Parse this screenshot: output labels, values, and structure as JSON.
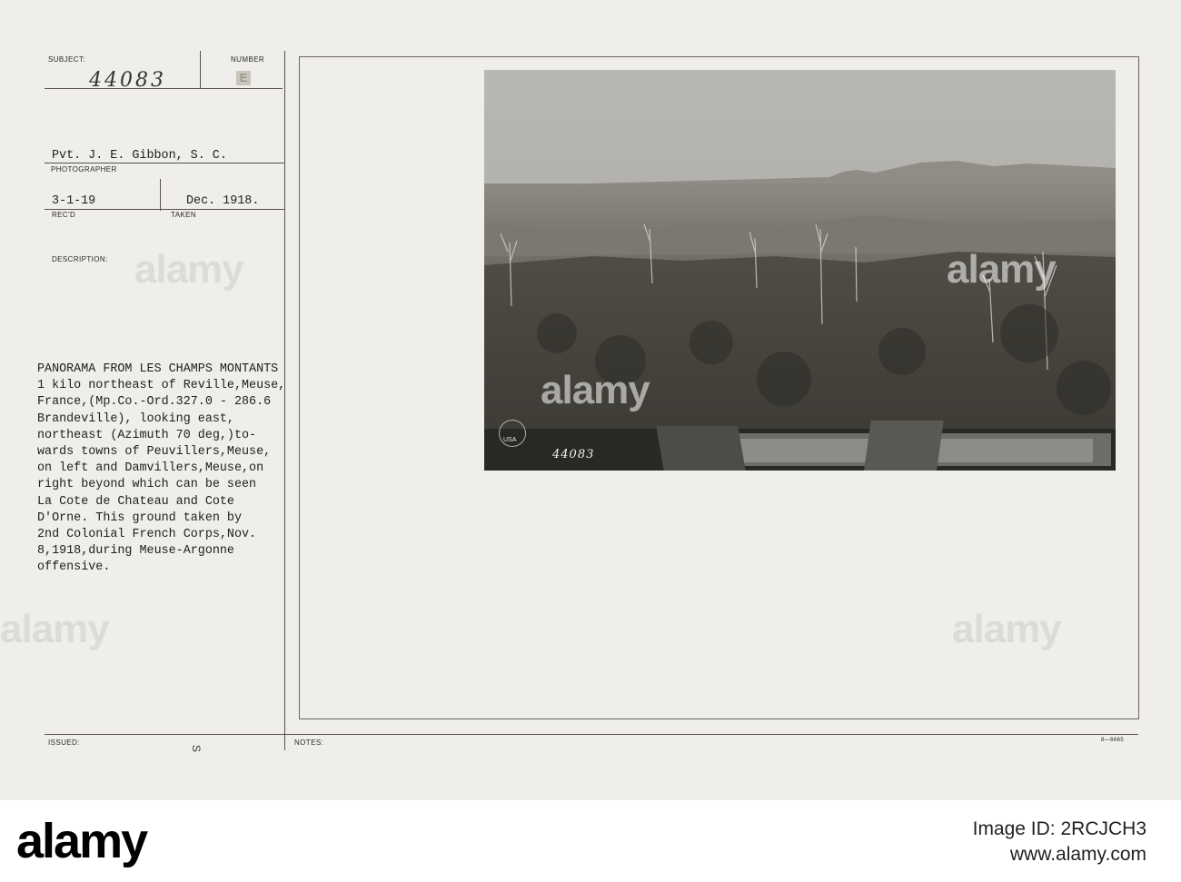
{
  "card": {
    "subject_label": "SUBJECT:",
    "subject_value": "44083",
    "number_label": "NUMBER",
    "number_value": "E",
    "photographer_name": "Pvt. J. E. Gibbon, S. C.",
    "photographer_label": "PHOTOGRAPHER",
    "received_value": "3-1-19",
    "received_label": "REC'D",
    "taken_value": "Dec. 1918.",
    "taken_label": "TAKEN",
    "description_label": "DESCRIPTION:",
    "description_lines": [
      "PANORAMA FROM LES CHAMPS MONTANTS",
      "1 kilo northeast of Reville,Meuse,",
      "France,(Mp.Co.-Ord.327.0 - 286.6",
      "Brandeville), looking east,",
      "northeast (Azimuth 70 deg,)to-",
      "wards towns of Peuvillers,Meuse,",
      "on left and Damvillers,Meuse,on",
      "right beyond which can be seen",
      "La Cote de Chateau and Cote",
      "D'Orne. This ground taken by",
      "2nd Colonial French Corps,Nov.",
      "8,1918,during Meuse-Argonne",
      "offensive."
    ],
    "issued_label": "ISSUED:",
    "notes_label": "NOTES:",
    "stamp_mark": "S",
    "corner_code": "8—6665"
  },
  "photo": {
    "negative_number": "44083",
    "stamp_text": "USA"
  },
  "watermark": {
    "text": "alamy"
  },
  "footer": {
    "brand": "alamy",
    "image_id_label": "Image ID: 2RCJCH3",
    "site": "www.alamy.com"
  }
}
